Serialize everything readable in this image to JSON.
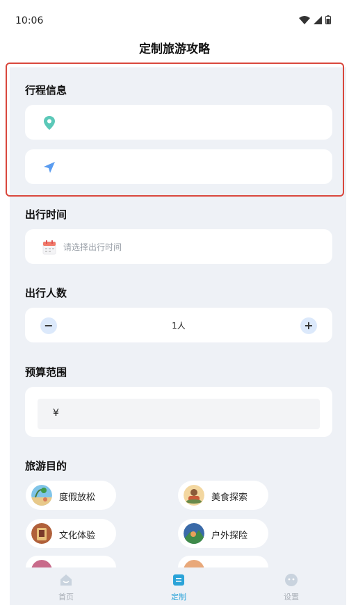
{
  "status_bar": {
    "time": "10:06"
  },
  "header": {
    "title": "定制旅游攻略"
  },
  "itinerary": {
    "title": "行程信息",
    "departure_value": "",
    "destination_value": ""
  },
  "travel_time": {
    "title": "出行时间",
    "placeholder": "请选择出行时间"
  },
  "travelers": {
    "title": "出行人数",
    "value": "1人",
    "minus_label": "−",
    "plus_label": "+"
  },
  "budget": {
    "title": "预算范围",
    "currency_symbol": "¥",
    "value": ""
  },
  "purpose": {
    "title": "旅游目的",
    "options": [
      {
        "label": "度假放松"
      },
      {
        "label": "美食探索"
      },
      {
        "label": "文化体验"
      },
      {
        "label": "户外探险"
      }
    ]
  },
  "tabs": [
    {
      "label": "首页",
      "icon": "home-icon",
      "active": false
    },
    {
      "label": "定制",
      "icon": "customize-icon",
      "active": true
    },
    {
      "label": "设置",
      "icon": "settings-icon",
      "active": false
    }
  ],
  "colors": {
    "accent": "#2aa3d8",
    "highlight": "#d9473c",
    "background": "#eef1f6",
    "pin": "#5bc8b8",
    "arrow": "#5a9cf0"
  }
}
